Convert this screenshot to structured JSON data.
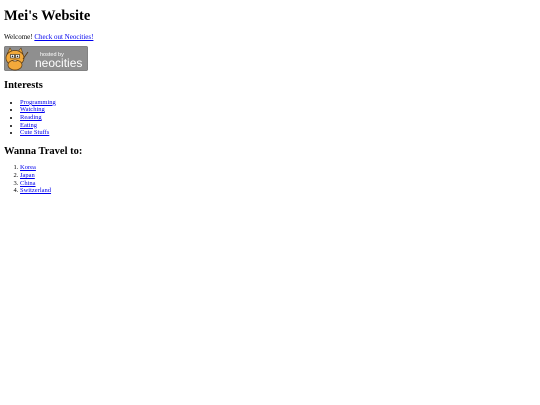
{
  "page": {
    "title": "Mei's Website",
    "welcome_text": "Welcome!",
    "neocities_link": "Check out Neocities!",
    "badge": {
      "line1": "hosted by",
      "line2": "neocities",
      "bg_color": "#8f8f8f",
      "cat_color": "#f2a93b"
    }
  },
  "interests": {
    "heading": "Interests",
    "items": [
      "Programming",
      "Watching",
      "Reading",
      "Eating",
      "Cute Stuffs"
    ]
  },
  "travel": {
    "heading": "Wanna Travel to:",
    "items": [
      "Korea",
      "Japan",
      "China",
      "Switzerland"
    ]
  },
  "colors": {
    "link": "#0000ee",
    "text": "#000000",
    "background": "#ffffff"
  }
}
